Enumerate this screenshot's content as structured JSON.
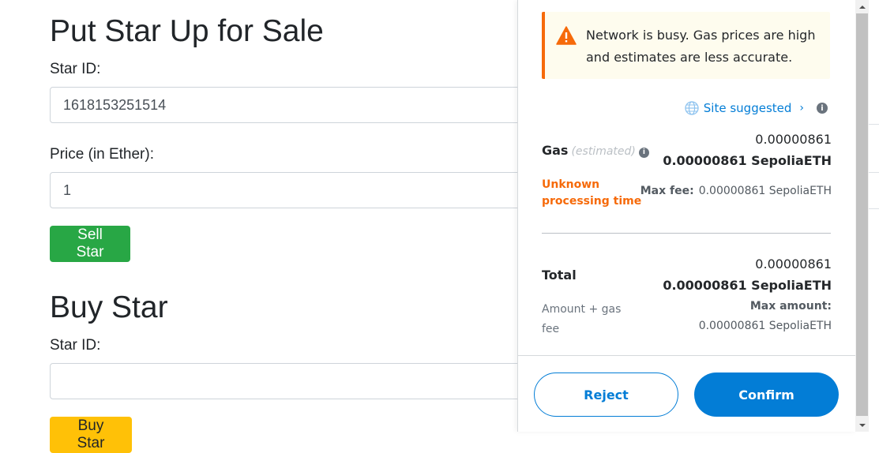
{
  "sell": {
    "heading": "Put Star Up for Sale",
    "star_id_label": "Star ID:",
    "star_id_value": "1618153251514",
    "price_label": "Price (in Ether):",
    "price_value": "1",
    "button": "Sell Star"
  },
  "buy": {
    "heading": "Buy Star",
    "star_id_label": "Star ID:",
    "star_id_value": "",
    "button": "Buy Star"
  },
  "metamask": {
    "alert": "Network is busy. Gas prices are high and estimates are less accurate.",
    "site_suggested": "Site suggested",
    "gas": {
      "label": "Gas",
      "estimated": "(estimated)",
      "value_small": "0.00000861",
      "value_bold": "0.00000861 SepoliaETH",
      "processing": "Unknown processing time",
      "max_fee_label": "Max fee:",
      "max_fee_value": "0.00000861 SepoliaETH"
    },
    "total": {
      "label": "Total",
      "value_small": "0.00000861",
      "value_bold": "0.00000861 SepoliaETH",
      "sub_label": "Amount + gas fee",
      "max_amount_label": "Max amount:",
      "max_amount_value": "0.00000861 SepoliaETH"
    },
    "reject": "Reject",
    "confirm": "Confirm"
  },
  "colors": {
    "primary": "#037dd6",
    "warning": "#f66a0a",
    "success": "#28a745",
    "yellow": "#ffc107"
  }
}
